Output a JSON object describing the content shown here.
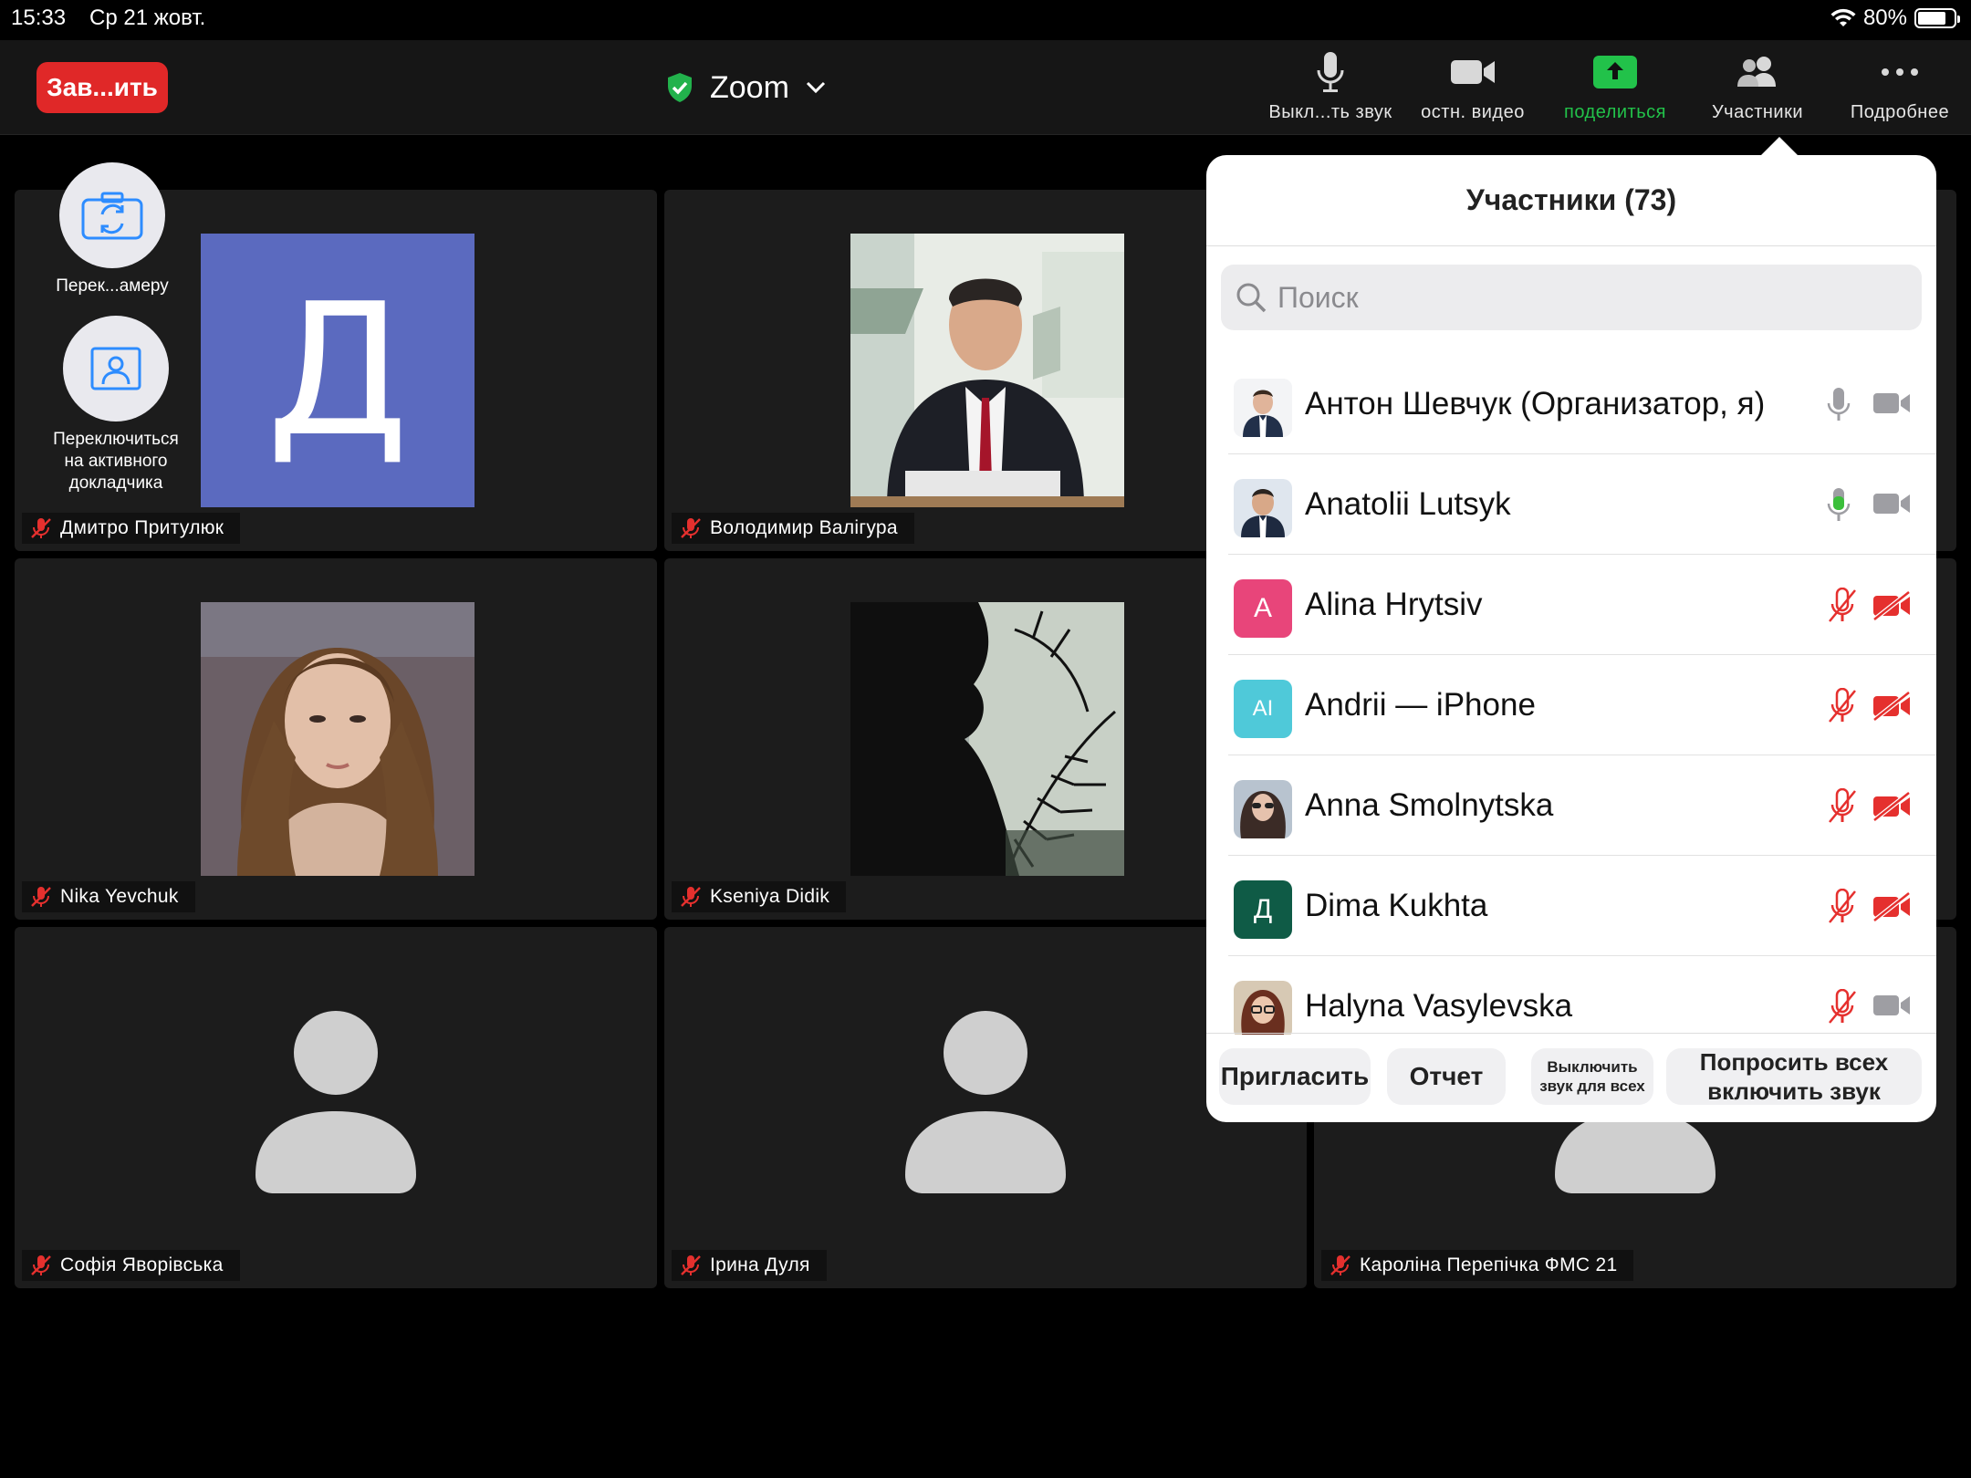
{
  "status": {
    "time": "15:33",
    "date": "Ср 21 жовт.",
    "battery": "80%",
    "battery_level": 0.8
  },
  "topbar": {
    "end_label": "Зав...ить",
    "title": "Zoom",
    "tools": [
      {
        "label": "Выкл...ть звук",
        "icon": "mic-icon"
      },
      {
        "label": "остн. видео",
        "icon": "video-camera-icon"
      },
      {
        "label": "поделиться",
        "icon": "share-icon"
      },
      {
        "label": "Участники",
        "icon": "participants-icon"
      },
      {
        "label": "Подробнее",
        "icon": "more-icon"
      }
    ]
  },
  "floating": {
    "switch_camera": "Перек...амеру",
    "active_speaker": "Переключиться на активного докладчика"
  },
  "tiles": [
    {
      "name": "Дмитро Притулюк",
      "avatar_letter": "Д"
    },
    {
      "name": "Володимир Валігура"
    },
    {
      "name": "Nika Yevchuk"
    },
    {
      "name": "Kseniya Didik"
    },
    {
      "name": "Софія Яворівська"
    },
    {
      "name": "Ірина Дуля"
    },
    {
      "name": "Кароліна Перепічка ФМС 21"
    }
  ],
  "participants_panel": {
    "title": "Участники (73)",
    "search_placeholder": "Поиск",
    "participants": [
      {
        "name": "Антон Шевчук (Организатор, я)",
        "avatar": "photo",
        "mic": "on",
        "cam": "on"
      },
      {
        "name": "Anatolii Lutsyk",
        "avatar": "photo",
        "mic": "speaking",
        "cam": "on"
      },
      {
        "name": "Alina Hrytsiv",
        "avatar": "A",
        "avatar_color": "#e8457a",
        "mic": "muted",
        "cam": "off"
      },
      {
        "name": "Andrii — iPhone",
        "avatar": "AI",
        "avatar_color": "#4fc9d9",
        "mic": "muted",
        "cam": "off"
      },
      {
        "name": "Anna Smolnytska",
        "avatar": "photo",
        "mic": "muted",
        "cam": "off"
      },
      {
        "name": "Dima Kukhta",
        "avatar": "Д",
        "avatar_color": "#0f5b46",
        "mic": "muted",
        "cam": "off"
      },
      {
        "name": "Halyna Vasylevska",
        "avatar": "photo",
        "mic": "muted",
        "cam": "on"
      }
    ],
    "footer": {
      "invite": "Пригласить",
      "report": "Отчет",
      "mute_all": "Выключить звук для всех",
      "ask_unmute": "Попросить всех включить звук"
    }
  },
  "colors": {
    "end_red": "#e02828",
    "share_green": "#22c24a",
    "muted_red": "#e5302e",
    "tile_bg": "#1c1c1c"
  }
}
